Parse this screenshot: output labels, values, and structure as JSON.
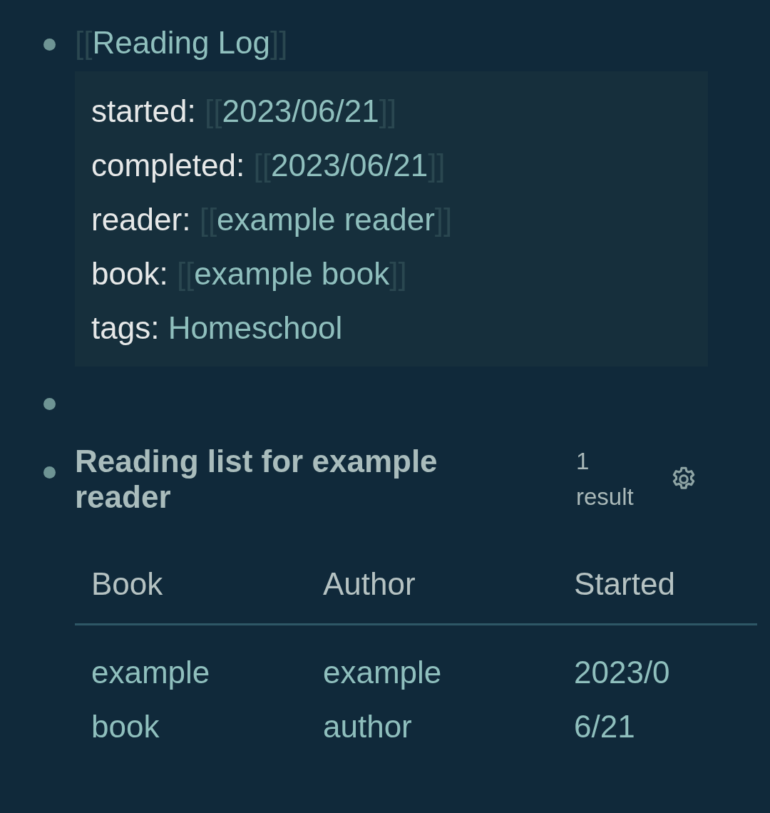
{
  "blocks": [
    {
      "kind": "page-link",
      "link": {
        "open": "[[",
        "text": "Reading Log",
        "close": "]]"
      },
      "properties": [
        {
          "key": "started:",
          "kind": "link",
          "value": {
            "open": "[[",
            "text": "2023/06/21",
            "close": "]]"
          }
        },
        {
          "key": "completed:",
          "kind": "link",
          "value": {
            "open": "[[",
            "text": "2023/06/21",
            "close": "]]"
          }
        },
        {
          "key": "reader:",
          "kind": "link",
          "value": {
            "open": "[[",
            "text": "example reader",
            "close": "]]"
          }
        },
        {
          "key": "book:",
          "kind": "link",
          "value": {
            "open": "[[",
            "text": "example book",
            "close": "]]"
          }
        },
        {
          "key": "tags:",
          "kind": "tag",
          "value": {
            "text": "Homeschool"
          }
        }
      ]
    },
    {
      "kind": "empty"
    },
    {
      "kind": "query",
      "title": "Reading list for example reader",
      "count": "1 result",
      "table": {
        "columns": [
          "Book",
          "Author",
          "Started"
        ],
        "rows": [
          [
            "example book",
            "example author",
            "2023/06/21"
          ]
        ]
      }
    }
  ]
}
